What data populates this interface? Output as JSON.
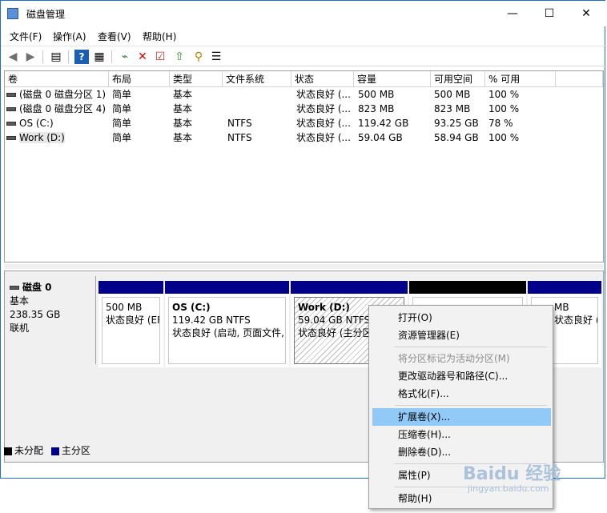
{
  "window": {
    "title": "磁盘管理",
    "minimize": "—",
    "maximize": "☐",
    "close": "✕"
  },
  "menu": [
    "文件(F)",
    "操作(A)",
    "查看(V)",
    "帮助(H)"
  ],
  "columns": [
    "卷",
    "布局",
    "类型",
    "文件系统",
    "状态",
    "容量",
    "可用空间",
    "% 可用"
  ],
  "volumes": [
    {
      "vol": "(磁盘 0 磁盘分区 1)",
      "layout": "简单",
      "type": "基本",
      "fs": "",
      "status": "状态良好 (...",
      "capacity": "500 MB",
      "free": "500 MB",
      "pct": "100 %"
    },
    {
      "vol": "(磁盘 0 磁盘分区 4)",
      "layout": "简单",
      "type": "基本",
      "fs": "",
      "status": "状态良好 (...",
      "capacity": "823 MB",
      "free": "823 MB",
      "pct": "100 %"
    },
    {
      "vol": "OS (C:)",
      "layout": "简单",
      "type": "基本",
      "fs": "NTFS",
      "status": "状态良好 (...",
      "capacity": "119.42 GB",
      "free": "93.25 GB",
      "pct": "78 %"
    },
    {
      "vol": "Work (D:)",
      "layout": "简单",
      "type": "基本",
      "fs": "NTFS",
      "status": "状态良好 (...",
      "capacity": "59.04 GB",
      "free": "58.94 GB",
      "pct": "100 %"
    }
  ],
  "disk": {
    "name": "磁盘 0",
    "kind": "基本",
    "size": "238.35 GB",
    "state": "联机"
  },
  "partitions": [
    {
      "title": "",
      "size": "500 MB",
      "status": "状态良好 (EF"
    },
    {
      "title": "OS  (C:)",
      "size": "119.42 GB NTFS",
      "status": "状态良好 (启动, 页面文件,"
    },
    {
      "title": "Work  (D:)",
      "size": "59.04 GB NTFS",
      "status": "状态良好 (主分区"
    },
    {
      "title": "",
      "size": "",
      "status": ""
    },
    {
      "title": "",
      "size": "MB",
      "status": "状态良好 (恢复"
    }
  ],
  "legend": {
    "unallocated": "未分配",
    "primary": "主分区"
  },
  "context_menu": {
    "open": "打开(O)",
    "explorer": "资源管理器(E)",
    "mark_active": "将分区标记为活动分区(M)",
    "change_letter": "更改驱动器号和路径(C)...",
    "format": "格式化(F)...",
    "extend": "扩展卷(X)...",
    "shrink": "压缩卷(H)...",
    "delete": "删除卷(D)...",
    "properties": "属性(P)",
    "help": "帮助(H)"
  },
  "watermark": {
    "logo": "Baidu 经验",
    "url": "jingyan.baidu.com"
  },
  "colors": {
    "primary_partition": "#00008b",
    "unallocated": "#000000",
    "highlight": "#91c9f7"
  }
}
